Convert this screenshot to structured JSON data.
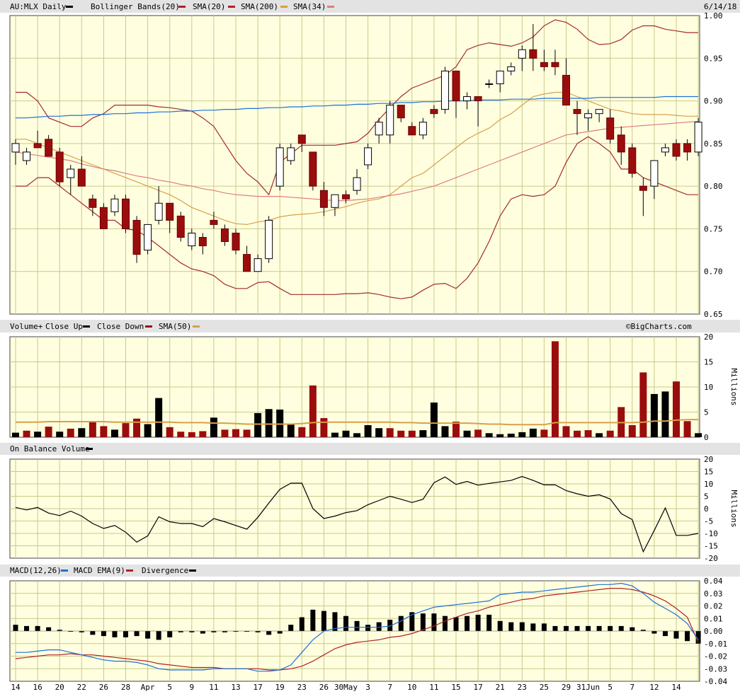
{
  "chart_data": [
    {
      "type": "candlestick",
      "legend": {
        "symbol": "AU:MLX Daily",
        "bollinger": "Bollinger Bands(20)",
        "sma20": "SMA(20)",
        "sma200": "SMA(200)",
        "sma34": "SMA(34)"
      },
      "date_label": "6/14/18",
      "ylim": [
        0.65,
        1.0
      ],
      "yticks": [
        "1.00",
        "0.95",
        "0.90",
        "0.85",
        "0.80",
        "0.75",
        "0.70",
        "0.65"
      ],
      "x_ticks": [
        "14",
        "16",
        "20",
        "22",
        "26",
        "28",
        "Apr",
        "5",
        "9",
        "11",
        "13",
        "17",
        "19",
        "23",
        "26",
        "30May",
        "3",
        "7",
        "10",
        "11",
        "15",
        "17",
        "21",
        "23",
        "25",
        "29",
        "31Jun",
        "5",
        "7",
        "12",
        "14"
      ],
      "ohlc": [
        [
          0.84,
          0.855,
          0.825,
          0.85
        ],
        [
          0.83,
          0.845,
          0.825,
          0.84
        ],
        [
          0.85,
          0.865,
          0.845,
          0.845
        ],
        [
          0.855,
          0.86,
          0.835,
          0.835
        ],
        [
          0.84,
          0.845,
          0.8,
          0.805
        ],
        [
          0.81,
          0.825,
          0.79,
          0.82
        ],
        [
          0.82,
          0.835,
          0.8,
          0.8
        ],
        [
          0.785,
          0.79,
          0.765,
          0.775
        ],
        [
          0.775,
          0.78,
          0.75,
          0.75
        ],
        [
          0.77,
          0.79,
          0.765,
          0.785
        ],
        [
          0.785,
          0.79,
          0.745,
          0.75
        ],
        [
          0.76,
          0.765,
          0.71,
          0.72
        ],
        [
          0.725,
          0.755,
          0.72,
          0.755
        ],
        [
          0.76,
          0.8,
          0.755,
          0.78
        ],
        [
          0.78,
          0.78,
          0.745,
          0.76
        ],
        [
          0.765,
          0.77,
          0.735,
          0.74
        ],
        [
          0.73,
          0.75,
          0.725,
          0.745
        ],
        [
          0.74,
          0.745,
          0.72,
          0.73
        ],
        [
          0.76,
          0.77,
          0.75,
          0.755
        ],
        [
          0.75,
          0.755,
          0.73,
          0.735
        ],
        [
          0.745,
          0.75,
          0.72,
          0.725
        ],
        [
          0.72,
          0.73,
          0.7,
          0.7
        ],
        [
          0.7,
          0.72,
          0.7,
          0.715
        ],
        [
          0.715,
          0.765,
          0.71,
          0.76
        ],
        [
          0.8,
          0.85,
          0.795,
          0.845
        ],
        [
          0.83,
          0.85,
          0.825,
          0.845
        ],
        [
          0.86,
          0.86,
          0.84,
          0.85
        ],
        [
          0.84,
          0.84,
          0.795,
          0.8
        ],
        [
          0.795,
          0.805,
          0.765,
          0.775
        ],
        [
          0.775,
          0.79,
          0.765,
          0.79
        ],
        [
          0.79,
          0.795,
          0.78,
          0.785
        ],
        [
          0.795,
          0.82,
          0.79,
          0.81
        ],
        [
          0.825,
          0.85,
          0.82,
          0.845
        ],
        [
          0.86,
          0.88,
          0.85,
          0.875
        ],
        [
          0.86,
          0.9,
          0.85,
          0.895
        ],
        [
          0.895,
          0.895,
          0.875,
          0.88
        ],
        [
          0.87,
          0.875,
          0.86,
          0.86
        ],
        [
          0.86,
          0.88,
          0.855,
          0.875
        ],
        [
          0.89,
          0.895,
          0.88,
          0.885
        ],
        [
          0.89,
          0.94,
          0.885,
          0.935
        ],
        [
          0.935,
          0.935,
          0.88,
          0.9
        ],
        [
          0.9,
          0.91,
          0.89,
          0.905
        ],
        [
          0.905,
          0.905,
          0.87,
          0.9
        ],
        [
          0.92,
          0.925,
          0.915,
          0.92
        ],
        [
          0.92,
          0.935,
          0.91,
          0.935
        ],
        [
          0.935,
          0.945,
          0.93,
          0.94
        ],
        [
          0.95,
          0.965,
          0.935,
          0.96
        ],
        [
          0.96,
          0.99,
          0.935,
          0.95
        ],
        [
          0.945,
          0.96,
          0.935,
          0.94
        ],
        [
          0.945,
          0.96,
          0.93,
          0.94
        ],
        [
          0.93,
          0.95,
          0.9,
          0.895
        ],
        [
          0.89,
          0.9,
          0.86,
          0.885
        ],
        [
          0.88,
          0.89,
          0.865,
          0.885
        ],
        [
          0.885,
          0.89,
          0.875,
          0.89
        ],
        [
          0.88,
          0.89,
          0.85,
          0.855
        ],
        [
          0.86,
          0.87,
          0.825,
          0.84
        ],
        [
          0.845,
          0.85,
          0.81,
          0.815
        ],
        [
          0.8,
          0.81,
          0.765,
          0.795
        ],
        [
          0.8,
          0.83,
          0.785,
          0.83
        ],
        [
          0.84,
          0.85,
          0.835,
          0.845
        ],
        [
          0.85,
          0.855,
          0.83,
          0.835
        ],
        [
          0.85,
          0.855,
          0.83,
          0.84
        ],
        [
          0.84,
          0.88,
          0.835,
          0.875
        ]
      ],
      "bb_upper": [
        0.91,
        0.91,
        0.9,
        0.88,
        0.875,
        0.87,
        0.87,
        0.88,
        0.885,
        0.895,
        0.895,
        0.895,
        0.895,
        0.893,
        0.892,
        0.89,
        0.888,
        0.88,
        0.87,
        0.85,
        0.83,
        0.815,
        0.805,
        0.79,
        0.828,
        0.838,
        0.848,
        0.848,
        0.848,
        0.848,
        0.85,
        0.852,
        0.862,
        0.878,
        0.892,
        0.905,
        0.915,
        0.92,
        0.925,
        0.93,
        0.94,
        0.96,
        0.965,
        0.968,
        0.966,
        0.964,
        0.968,
        0.975,
        0.988,
        0.995,
        0.992,
        0.984,
        0.972,
        0.966,
        0.967,
        0.972,
        0.983,
        0.988,
        0.988,
        0.984,
        0.982,
        0.98,
        0.98
      ],
      "bb_lower": [
        0.8,
        0.8,
        0.81,
        0.81,
        0.8,
        0.79,
        0.78,
        0.77,
        0.76,
        0.76,
        0.75,
        0.748,
        0.74,
        0.73,
        0.72,
        0.71,
        0.703,
        0.7,
        0.695,
        0.685,
        0.68,
        0.68,
        0.687,
        0.688,
        0.68,
        0.673,
        0.673,
        0.673,
        0.673,
        0.673,
        0.674,
        0.674,
        0.675,
        0.673,
        0.67,
        0.668,
        0.67,
        0.678,
        0.685,
        0.686,
        0.68,
        0.692,
        0.71,
        0.735,
        0.765,
        0.785,
        0.79,
        0.788,
        0.79,
        0.8,
        0.828,
        0.85,
        0.858,
        0.85,
        0.84,
        0.82,
        0.82,
        0.81,
        0.805,
        0.8,
        0.795,
        0.79,
        0.79
      ],
      "sma20": [
        0.855,
        0.855,
        0.85,
        0.845,
        0.84,
        0.835,
        0.83,
        0.825,
        0.82,
        0.815,
        0.81,
        0.805,
        0.8,
        0.795,
        0.79,
        0.783,
        0.775,
        0.77,
        0.765,
        0.76,
        0.756,
        0.755,
        0.758,
        0.76,
        0.764,
        0.766,
        0.767,
        0.768,
        0.77,
        0.773,
        0.776,
        0.78,
        0.783,
        0.785,
        0.79,
        0.8,
        0.81,
        0.815,
        0.825,
        0.835,
        0.845,
        0.855,
        0.862,
        0.868,
        0.878,
        0.885,
        0.895,
        0.905,
        0.908,
        0.91,
        0.91,
        0.905,
        0.9,
        0.895,
        0.89,
        0.888,
        0.885,
        0.884,
        0.884,
        0.884,
        0.883,
        0.882,
        0.882
      ],
      "sma200": [
        0.88,
        0.88,
        0.881,
        0.882,
        0.882,
        0.883,
        0.883,
        0.884,
        0.884,
        0.885,
        0.885,
        0.886,
        0.886,
        0.887,
        0.887,
        0.888,
        0.888,
        0.889,
        0.889,
        0.89,
        0.89,
        0.891,
        0.891,
        0.892,
        0.892,
        0.893,
        0.893,
        0.894,
        0.894,
        0.895,
        0.895,
        0.896,
        0.896,
        0.897,
        0.897,
        0.898,
        0.898,
        0.899,
        0.899,
        0.9,
        0.9,
        0.9,
        0.901,
        0.901,
        0.901,
        0.902,
        0.902,
        0.902,
        0.903,
        0.903,
        0.903,
        0.903,
        0.903,
        0.904,
        0.904,
        0.904,
        0.904,
        0.904,
        0.904,
        0.905,
        0.905,
        0.905,
        0.905
      ],
      "sma34": [
        0.84,
        0.838,
        0.836,
        0.834,
        0.832,
        0.83,
        0.826,
        0.823,
        0.82,
        0.818,
        0.815,
        0.812,
        0.81,
        0.807,
        0.805,
        0.802,
        0.8,
        0.797,
        0.795,
        0.792,
        0.79,
        0.789,
        0.788,
        0.788,
        0.788,
        0.787,
        0.786,
        0.785,
        0.784,
        0.783,
        0.783,
        0.784,
        0.785,
        0.787,
        0.789,
        0.791,
        0.794,
        0.797,
        0.8,
        0.805,
        0.81,
        0.815,
        0.82,
        0.825,
        0.83,
        0.835,
        0.84,
        0.845,
        0.85,
        0.855,
        0.86,
        0.862,
        0.864,
        0.866,
        0.868,
        0.869,
        0.87,
        0.871,
        0.872,
        0.873,
        0.874,
        0.875,
        0.876
      ]
    },
    {
      "type": "bar",
      "legend": {
        "title": "Volume+",
        "up": "Close Up",
        "down": "Close Down",
        "sma": "SMA(50)"
      },
      "watermark": "©BigCharts.com",
      "ylim": [
        0,
        20
      ],
      "yticks": [
        "20",
        "15",
        "10",
        "5",
        "0"
      ],
      "unit": "Millions",
      "volume": [
        0.9,
        1.3,
        1.1,
        2.1,
        1.1,
        1.7,
        1.8,
        3.2,
        2.2,
        1.5,
        2.8,
        3.7,
        2.6,
        7.8,
        2.0,
        1.1,
        1.0,
        1.2,
        3.9,
        1.5,
        1.6,
        1.5,
        4.8,
        5.6,
        5.5,
        2.6,
        2.0,
        10.3,
        3.8,
        0.9,
        1.3,
        0.8,
        2.4,
        1.8,
        1.8,
        1.3,
        1.3,
        1.4,
        6.9,
        2.2,
        3.1,
        1.3,
        1.5,
        0.8,
        0.6,
        0.7,
        1.0,
        1.7,
        1.5,
        19.1,
        2.2,
        1.3,
        1.4,
        0.8,
        1.3,
        6.0,
        2.4,
        12.9,
        8.6,
        9.1,
        11.1,
        3.2,
        0.8
      ],
      "up": [
        1,
        0,
        1,
        0,
        1,
        0,
        1,
        0,
        0,
        1,
        0,
        0,
        1,
        1,
        0,
        0,
        0,
        0,
        1,
        0,
        0,
        0,
        1,
        1,
        1,
        1,
        0,
        0,
        0,
        1,
        1,
        1,
        1,
        1,
        0,
        0,
        0,
        1,
        1,
        1,
        0,
        1,
        0,
        1,
        1,
        1,
        1,
        1,
        0,
        0,
        0,
        0,
        0,
        1,
        0,
        0,
        0,
        0,
        1,
        1,
        0,
        0,
        1
      ],
      "sma50": [
        3.0,
        3.0,
        3.0,
        3.1,
        3.1,
        3.1,
        3.1,
        3.1,
        3.1,
        3.0,
        3.0,
        3.0,
        3.0,
        3.0,
        3.0,
        2.9,
        2.9,
        2.9,
        2.8,
        2.8,
        2.7,
        2.6,
        2.6,
        2.6,
        2.6,
        2.6,
        2.7,
        2.9,
        3.0,
        3.0,
        3.0,
        3.0,
        3.0,
        3.0,
        3.0,
        2.9,
        2.9,
        2.8,
        2.8,
        2.8,
        2.8,
        2.8,
        2.7,
        2.6,
        2.6,
        2.5,
        2.5,
        2.5,
        2.5,
        2.9,
        2.9,
        2.9,
        2.9,
        2.9,
        2.9,
        2.9,
        2.9,
        3.0,
        3.2,
        3.2,
        3.4,
        3.5,
        3.5
      ]
    },
    {
      "type": "line",
      "legend": {
        "title": "On Balance Volume"
      },
      "ylim": [
        -20,
        20
      ],
      "yticks": [
        "20",
        "15",
        "10",
        "5",
        "0",
        "-5",
        "-10",
        "-15",
        "-20"
      ],
      "unit": "Millions",
      "obv": [
        0.5,
        -0.5,
        0.5,
        -1.8,
        -2.8,
        -1.0,
        -3.0,
        -6.0,
        -8.0,
        -6.8,
        -9.5,
        -13.5,
        -11.0,
        -3.3,
        -5.3,
        -6.0,
        -6.0,
        -7.3,
        -4.0,
        -5.3,
        -6.8,
        -8.3,
        -3.5,
        2.3,
        7.8,
        10.3,
        10.3,
        0.0,
        -4.0,
        -3.0,
        -1.6,
        -0.8,
        1.6,
        3.3,
        5.0,
        3.8,
        2.5,
        3.8,
        10.5,
        12.8,
        9.8,
        11.0,
        9.5,
        10.2,
        10.8,
        11.4,
        13.0,
        11.4,
        9.6,
        9.6,
        7.3,
        6.0,
        5.0,
        5.6,
        3.9,
        -2.0,
        -4.4,
        -17.4,
        -8.8,
        0.3,
        -10.8,
        -10.8,
        -10.0
      ]
    },
    {
      "type": "line",
      "legend": {
        "title": "MACD(12,26)",
        "ema": "MACD EMA(9)",
        "div": "Divergence"
      },
      "ylim": [
        -0.04,
        0.04
      ],
      "yticks": [
        "0.04",
        "0.03",
        "0.02",
        "0.01",
        "0.00",
        "-0.01",
        "-0.02",
        "-0.03",
        "-0.04"
      ],
      "macd": [
        -0.017,
        -0.017,
        -0.016,
        -0.015,
        -0.015,
        -0.017,
        -0.019,
        -0.021,
        -0.023,
        -0.024,
        -0.024,
        -0.025,
        -0.027,
        -0.03,
        -0.031,
        -0.031,
        -0.031,
        -0.031,
        -0.03,
        -0.03,
        -0.03,
        -0.03,
        -0.032,
        -0.032,
        -0.031,
        -0.027,
        -0.017,
        -0.007,
        0.0,
        0.002,
        0.003,
        0.003,
        0.003,
        0.003,
        0.004,
        0.008,
        0.013,
        0.016,
        0.019,
        0.02,
        0.021,
        0.022,
        0.023,
        0.024,
        0.029,
        0.03,
        0.031,
        0.031,
        0.032,
        0.033,
        0.034,
        0.035,
        0.036,
        0.037,
        0.037,
        0.038,
        0.036,
        0.03,
        0.023,
        0.018,
        0.013,
        0.006,
        -0.007
      ],
      "ema": [
        -0.022,
        -0.021,
        -0.02,
        -0.019,
        -0.019,
        -0.018,
        -0.019,
        -0.019,
        -0.02,
        -0.021,
        -0.022,
        -0.023,
        -0.024,
        -0.026,
        -0.027,
        -0.028,
        -0.029,
        -0.029,
        -0.029,
        -0.03,
        -0.03,
        -0.03,
        -0.03,
        -0.031,
        -0.031,
        -0.03,
        -0.028,
        -0.024,
        -0.019,
        -0.014,
        -0.011,
        -0.009,
        -0.008,
        -0.007,
        -0.005,
        -0.004,
        -0.002,
        0.001,
        0.004,
        0.008,
        0.011,
        0.014,
        0.016,
        0.019,
        0.021,
        0.023,
        0.025,
        0.026,
        0.028,
        0.029,
        0.03,
        0.031,
        0.032,
        0.033,
        0.034,
        0.034,
        0.033,
        0.031,
        0.028,
        0.024,
        0.018,
        0.011,
        -0.009
      ],
      "divergence": [
        0.005,
        0.004,
        0.004,
        0.003,
        0.001,
        0.0,
        -0.001,
        -0.003,
        -0.004,
        -0.005,
        -0.005,
        -0.004,
        -0.006,
        -0.007,
        -0.005,
        -0.001,
        -0.001,
        -0.002,
        -0.001,
        -0.001,
        0.0,
        0.0,
        -0.001,
        -0.003,
        -0.002,
        0.005,
        0.011,
        0.017,
        0.016,
        0.015,
        0.012,
        0.008,
        0.005,
        0.007,
        0.009,
        0.012,
        0.015,
        0.014,
        0.014,
        0.012,
        0.011,
        0.012,
        0.013,
        0.013,
        0.008,
        0.007,
        0.007,
        0.006,
        0.006,
        0.004,
        0.004,
        0.004,
        0.004,
        0.004,
        0.004,
        0.004,
        0.003,
        0.001,
        -0.002,
        -0.004,
        -0.006,
        -0.008,
        -0.01
      ]
    }
  ]
}
